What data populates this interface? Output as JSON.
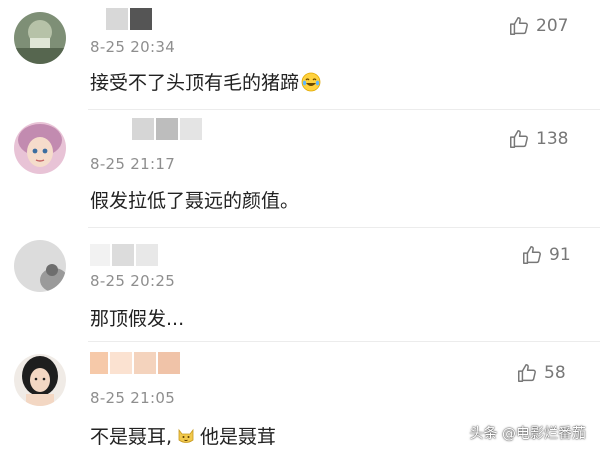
{
  "comments": [
    {
      "meta": "8-25 20:34",
      "text": "接受不了头顶有毛的猪蹄",
      "likes": "207",
      "emoji": "laughing-crying-emoji"
    },
    {
      "meta": "8-25 21:17",
      "text": "假发拉低了聂远的颜值。",
      "likes": "138"
    },
    {
      "meta": "8-25 20:25",
      "text": "那顶假发...",
      "likes": "91"
    },
    {
      "meta": "8-25 21:05",
      "text_before": "不是聂耳,",
      "text_after": "他是聂茸",
      "likes": "58",
      "emoji": "cat-face-emoji"
    }
  ],
  "watermark": {
    "text": "头条 @电影烂番茄"
  }
}
